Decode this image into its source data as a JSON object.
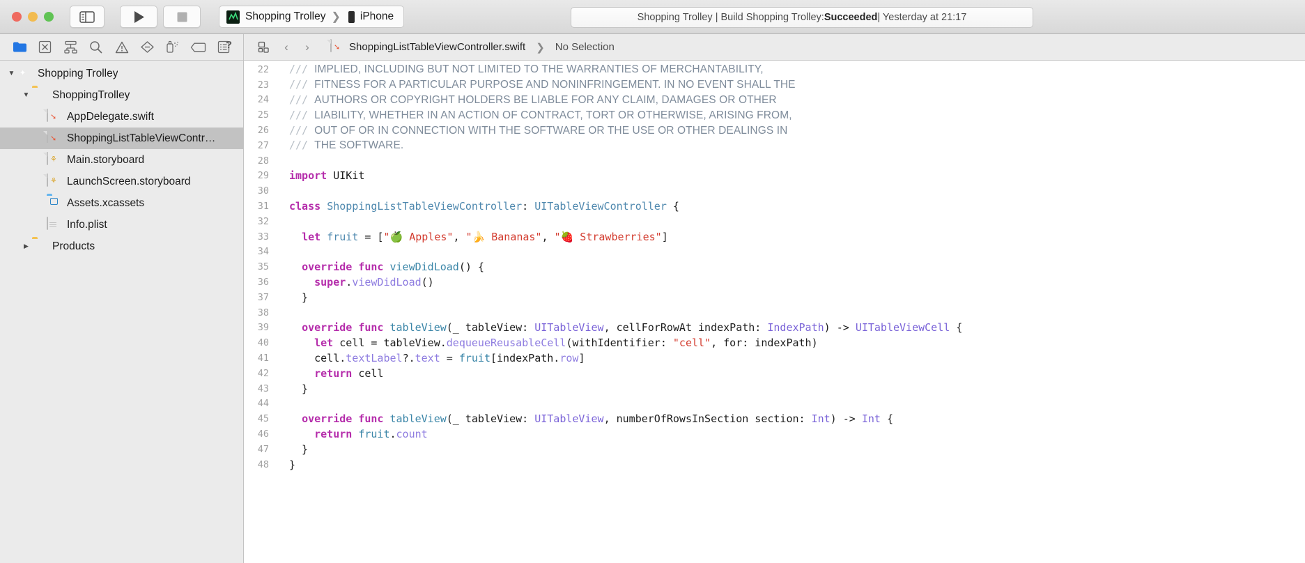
{
  "titlebar": {
    "window_controls": [
      "close",
      "minimize",
      "zoom"
    ],
    "sidebar_toggle_label": "Toggle Navigator",
    "run_label": "Run",
    "stop_label": "Stop",
    "scheme_name": "Shopping Trolley",
    "scheme_separator": "❯",
    "device_name": "iPhone",
    "status_prefix": "Shopping Trolley | Build Shopping Trolley: ",
    "status_result": "Succeeded",
    "status_suffix": " | Yesterday at 21:17"
  },
  "navigator": {
    "toolbar_icons": [
      {
        "name": "folder-icon",
        "label": "Project navigator",
        "active": true
      },
      {
        "name": "source-control-icon",
        "label": "Source control navigator",
        "active": false
      },
      {
        "name": "symbol-hierarchy-icon",
        "label": "Symbol navigator",
        "active": false
      },
      {
        "name": "search-icon",
        "label": "Find navigator",
        "active": false
      },
      {
        "name": "warning-triangle-icon",
        "label": "Issue navigator",
        "active": false
      },
      {
        "name": "test-diamond-icon",
        "label": "Test navigator",
        "active": false
      },
      {
        "name": "debug-spray-icon",
        "label": "Debug navigator",
        "active": false
      },
      {
        "name": "breakpoint-tag-icon",
        "label": "Breakpoint navigator",
        "active": false
      },
      {
        "name": "report-icon",
        "label": "Report navigator",
        "active": false
      }
    ],
    "help_badge": "?",
    "tree": [
      {
        "label": "Shopping Trolley",
        "icon": "project-icon",
        "indent": 0,
        "twisty": "open",
        "selected": false
      },
      {
        "label": "ShoppingTrolley",
        "icon": "folder-icon",
        "indent": 1,
        "twisty": "open",
        "selected": false
      },
      {
        "label": "AppDelegate.swift",
        "icon": "swift-file-icon",
        "indent": 2,
        "twisty": "none",
        "selected": false
      },
      {
        "label": "ShoppingListTableViewContr…",
        "icon": "swift-file-icon",
        "indent": 2,
        "twisty": "none",
        "selected": true
      },
      {
        "label": "Main.storyboard",
        "icon": "storyboard-file-icon",
        "indent": 2,
        "twisty": "none",
        "selected": false
      },
      {
        "label": "LaunchScreen.storyboard",
        "icon": "storyboard-file-icon",
        "indent": 2,
        "twisty": "none",
        "selected": false
      },
      {
        "label": "Assets.xcassets",
        "icon": "assets-folder-icon",
        "indent": 2,
        "twisty": "none",
        "selected": false
      },
      {
        "label": "Info.plist",
        "icon": "plist-file-icon",
        "indent": 2,
        "twisty": "none",
        "selected": false
      },
      {
        "label": "Products",
        "icon": "folder-icon",
        "indent": 1,
        "twisty": "closed",
        "selected": false
      }
    ]
  },
  "jumpbar": {
    "related_items_label": "Related Items",
    "back_label": "‹",
    "forward_label": "›",
    "file_name": "ShoppingListTableViewController.swift",
    "separator": "❯",
    "selection": "No Selection"
  },
  "code": {
    "first_line_number": 22,
    "lines": [
      {
        "n": 22,
        "tokens": [
          {
            "t": "/// ",
            "c": "slash"
          },
          {
            "t": "IMPLIED, INCLUDING BUT NOT LIMITED TO THE WARRANTIES OF MERCHANTABILITY,",
            "c": "comment"
          }
        ]
      },
      {
        "n": 23,
        "tokens": [
          {
            "t": "/// ",
            "c": "slash"
          },
          {
            "t": "FITNESS FOR A PARTICULAR PURPOSE AND NONINFRINGEMENT. IN NO EVENT SHALL THE",
            "c": "comment"
          }
        ]
      },
      {
        "n": 24,
        "tokens": [
          {
            "t": "/// ",
            "c": "slash"
          },
          {
            "t": "AUTHORS OR COPYRIGHT HOLDERS BE LIABLE FOR ANY CLAIM, DAMAGES OR OTHER",
            "c": "comment"
          }
        ]
      },
      {
        "n": 25,
        "tokens": [
          {
            "t": "/// ",
            "c": "slash"
          },
          {
            "t": "LIABILITY, WHETHER IN AN ACTION OF CONTRACT, TORT OR OTHERWISE, ARISING FROM,",
            "c": "comment"
          }
        ]
      },
      {
        "n": 26,
        "tokens": [
          {
            "t": "/// ",
            "c": "slash"
          },
          {
            "t": "OUT OF OR IN CONNECTION WITH THE SOFTWARE OR THE USE OR OTHER DEALINGS IN",
            "c": "comment"
          }
        ]
      },
      {
        "n": 27,
        "tokens": [
          {
            "t": "/// ",
            "c": "slash"
          },
          {
            "t": "THE SOFTWARE.",
            "c": "comment"
          }
        ]
      },
      {
        "n": 28,
        "tokens": []
      },
      {
        "n": 29,
        "tokens": [
          {
            "t": "import",
            "c": "kw"
          },
          {
            "t": " UIKit",
            "c": "plain"
          }
        ]
      },
      {
        "n": 30,
        "tokens": []
      },
      {
        "n": 31,
        "tokens": [
          {
            "t": "class",
            "c": "kw"
          },
          {
            "t": " ",
            "c": "plain"
          },
          {
            "t": "ShoppingListTableViewController",
            "c": "type"
          },
          {
            "t": ": ",
            "c": "plain"
          },
          {
            "t": "UITableViewController",
            "c": "type"
          },
          {
            "t": " {",
            "c": "plain"
          }
        ]
      },
      {
        "n": 32,
        "tokens": []
      },
      {
        "n": 33,
        "tokens": [
          {
            "t": "  ",
            "c": "plain"
          },
          {
            "t": "let",
            "c": "kw"
          },
          {
            "t": " ",
            "c": "plain"
          },
          {
            "t": "fruit",
            "c": "type"
          },
          {
            "t": " = [",
            "c": "plain"
          },
          {
            "t": "\"🍏 Apples\"",
            "c": "str"
          },
          {
            "t": ", ",
            "c": "plain"
          },
          {
            "t": "\"🍌 Bananas\"",
            "c": "str"
          },
          {
            "t": ", ",
            "c": "plain"
          },
          {
            "t": "\"🍓 Strawberries\"",
            "c": "str"
          },
          {
            "t": "]",
            "c": "plain"
          }
        ]
      },
      {
        "n": 34,
        "tokens": []
      },
      {
        "n": 35,
        "tokens": [
          {
            "t": "  ",
            "c": "plain"
          },
          {
            "t": "override func",
            "c": "kw"
          },
          {
            "t": " ",
            "c": "plain"
          },
          {
            "t": "viewDidLoad",
            "c": "method"
          },
          {
            "t": "() {",
            "c": "plain"
          }
        ]
      },
      {
        "n": 36,
        "tokens": [
          {
            "t": "    ",
            "c": "plain"
          },
          {
            "t": "super",
            "c": "kw"
          },
          {
            "t": ".",
            "c": "plain"
          },
          {
            "t": "viewDidLoad",
            "c": "prop"
          },
          {
            "t": "()",
            "c": "plain"
          }
        ]
      },
      {
        "n": 37,
        "tokens": [
          {
            "t": "  }",
            "c": "plain"
          }
        ]
      },
      {
        "n": 38,
        "tokens": []
      },
      {
        "n": 39,
        "tokens": [
          {
            "t": "  ",
            "c": "plain"
          },
          {
            "t": "override func",
            "c": "kw"
          },
          {
            "t": " ",
            "c": "plain"
          },
          {
            "t": "tableView",
            "c": "method"
          },
          {
            "t": "(_ tableView: ",
            "c": "plain"
          },
          {
            "t": "UITableView",
            "c": "type2"
          },
          {
            "t": ", cellForRowAt indexPath: ",
            "c": "plain"
          },
          {
            "t": "IndexPath",
            "c": "type2"
          },
          {
            "t": ") -> ",
            "c": "plain"
          },
          {
            "t": "UITableViewCell",
            "c": "type2"
          },
          {
            "t": " {",
            "c": "plain"
          }
        ]
      },
      {
        "n": 40,
        "tokens": [
          {
            "t": "    ",
            "c": "plain"
          },
          {
            "t": "let",
            "c": "kw"
          },
          {
            "t": " cell = tableView.",
            "c": "plain"
          },
          {
            "t": "dequeueReusableCell",
            "c": "prop"
          },
          {
            "t": "(withIdentifier: ",
            "c": "plain"
          },
          {
            "t": "\"cell\"",
            "c": "str"
          },
          {
            "t": ", for: indexPath)",
            "c": "plain"
          }
        ]
      },
      {
        "n": 41,
        "tokens": [
          {
            "t": "    cell.",
            "c": "plain"
          },
          {
            "t": "textLabel",
            "c": "prop"
          },
          {
            "t": "?.",
            "c": "plain"
          },
          {
            "t": "text",
            "c": "prop"
          },
          {
            "t": " = ",
            "c": "plain"
          },
          {
            "t": "fruit",
            "c": "method"
          },
          {
            "t": "[indexPath.",
            "c": "plain"
          },
          {
            "t": "row",
            "c": "prop"
          },
          {
            "t": "]",
            "c": "plain"
          }
        ]
      },
      {
        "n": 42,
        "tokens": [
          {
            "t": "    ",
            "c": "plain"
          },
          {
            "t": "return",
            "c": "kw"
          },
          {
            "t": " cell",
            "c": "plain"
          }
        ]
      },
      {
        "n": 43,
        "tokens": [
          {
            "t": "  }",
            "c": "plain"
          }
        ]
      },
      {
        "n": 44,
        "tokens": []
      },
      {
        "n": 45,
        "tokens": [
          {
            "t": "  ",
            "c": "plain"
          },
          {
            "t": "override func",
            "c": "kw"
          },
          {
            "t": " ",
            "c": "plain"
          },
          {
            "t": "tableView",
            "c": "method"
          },
          {
            "t": "(_ tableView: ",
            "c": "plain"
          },
          {
            "t": "UITableView",
            "c": "type2"
          },
          {
            "t": ", numberOfRowsInSection section: ",
            "c": "plain"
          },
          {
            "t": "Int",
            "c": "type2"
          },
          {
            "t": ") -> ",
            "c": "plain"
          },
          {
            "t": "Int",
            "c": "type2"
          },
          {
            "t": " {",
            "c": "plain"
          }
        ]
      },
      {
        "n": 46,
        "tokens": [
          {
            "t": "    ",
            "c": "plain"
          },
          {
            "t": "return",
            "c": "kw"
          },
          {
            "t": " ",
            "c": "plain"
          },
          {
            "t": "fruit",
            "c": "method"
          },
          {
            "t": ".",
            "c": "plain"
          },
          {
            "t": "count",
            "c": "prop"
          }
        ]
      },
      {
        "n": 47,
        "tokens": [
          {
            "t": "  }",
            "c": "plain"
          }
        ]
      },
      {
        "n": 48,
        "tokens": [
          {
            "t": "}",
            "c": "plain"
          }
        ]
      }
    ]
  },
  "colors": {
    "keyword": "#b52dab",
    "type": "#4e88ae",
    "type_system": "#7a63d8",
    "method": "#3b86a8",
    "property": "#8e7ce0",
    "string": "#d33c2f",
    "comment": "#7f8c9b",
    "accent": "#2276e3",
    "selection": "#c2c2c2"
  }
}
